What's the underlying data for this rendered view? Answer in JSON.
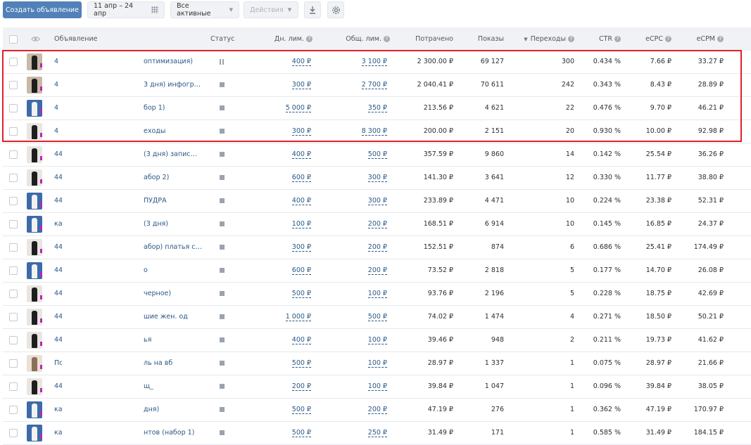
{
  "toolbar": {
    "create_label": "Создать объявление",
    "date_range": "11 апр – 24 апр",
    "filter_label": "Все активные",
    "actions_label": "Действия"
  },
  "columns": {
    "ad": "Объявление",
    "status": "Статус",
    "daily_limit": "Дн. лим.",
    "total_limit": "Общ. лим.",
    "spent": "Потрачено",
    "impressions": "Показы",
    "clicks": "Переходы",
    "ctr": "CTR",
    "ecpc": "eCPC",
    "ecpm": "eCPM"
  },
  "rows": [
    {
      "name": "4",
      "name_tail": "оптимизация)",
      "status": "paused",
      "daily": "400 ₽",
      "total": "3 100 ₽",
      "spent": "2 300.00 ₽",
      "impr": "69 127",
      "clicks": "300",
      "ctr": "0.434 %",
      "ecpc": "7.66 ₽",
      "ecpm": "33.27 ₽",
      "thumb": "multi"
    },
    {
      "name": "4",
      "name_tail": "3 дня) инфогр…",
      "status": "stopped",
      "daily": "300 ₽",
      "total": "2 700 ₽",
      "spent": "2 040.41 ₽",
      "impr": "70 611",
      "clicks": "242",
      "ctr": "0.343 %",
      "ecpc": "8.43 ₽",
      "ecpm": "28.89 ₽",
      "thumb": "multi"
    },
    {
      "name": "4",
      "name_tail": "бор 1)",
      "status": "stopped",
      "daily": "5 000 ₽",
      "total": "350 ₽",
      "spent": "213.56 ₽",
      "impr": "4 621",
      "clicks": "22",
      "ctr": "0.476 %",
      "ecpc": "9.70 ₽",
      "ecpm": "46.21 ₽",
      "thumb": "blue"
    },
    {
      "name": "4",
      "name_tail": "еходы",
      "status": "stopped",
      "daily": "300 ₽",
      "total": "8 300 ₽",
      "spent": "200.00 ₽",
      "impr": "2 151",
      "clicks": "20",
      "ctr": "0.930 %",
      "ecpc": "10.00 ₽",
      "ecpm": "92.98 ₽",
      "thumb": "dark"
    },
    {
      "name": "44",
      "name_tail": "(3 дня) запис…",
      "status": "stopped",
      "daily": "400 ₽",
      "total": "500 ₽",
      "spent": "357.59 ₽",
      "impr": "9 860",
      "clicks": "14",
      "ctr": "0.142 %",
      "ecpc": "25.54 ₽",
      "ecpm": "36.26 ₽",
      "thumb": "dark"
    },
    {
      "name": "44",
      "name_tail": "абор 2)",
      "status": "stopped",
      "daily": "600 ₽",
      "total": "300 ₽",
      "spent": "141.30 ₽",
      "impr": "3 641",
      "clicks": "12",
      "ctr": "0.330 %",
      "ecpc": "11.77 ₽",
      "ecpm": "38.80 ₽",
      "thumb": "dark"
    },
    {
      "name": "44",
      "name_tail": "ПУДРА",
      "status": "stopped",
      "daily": "400 ₽",
      "total": "300 ₽",
      "spent": "233.89 ₽",
      "impr": "4 471",
      "clicks": "10",
      "ctr": "0.224 %",
      "ecpc": "23.38 ₽",
      "ecpm": "52.31 ₽",
      "thumb": "blue"
    },
    {
      "name": "ка",
      "name_tail": "(3 дня)",
      "status": "stopped",
      "daily": "100 ₽",
      "total": "200 ₽",
      "spent": "168.51 ₽",
      "impr": "6 914",
      "clicks": "10",
      "ctr": "0.145 %",
      "ecpc": "16.85 ₽",
      "ecpm": "24.37 ₽",
      "thumb": "blue"
    },
    {
      "name": "44",
      "name_tail": "абор) платья с…",
      "status": "stopped",
      "daily": "300 ₽",
      "total": "200 ₽",
      "spent": "152.51 ₽",
      "impr": "874",
      "clicks": "6",
      "ctr": "0.686 %",
      "ecpc": "25.41 ₽",
      "ecpm": "174.49 ₽",
      "thumb": "dark"
    },
    {
      "name": "44",
      "name_tail": "о",
      "status": "stopped",
      "daily": "600 ₽",
      "total": "200 ₽",
      "spent": "73.52 ₽",
      "impr": "2 818",
      "clicks": "5",
      "ctr": "0.177 %",
      "ecpc": "14.70 ₽",
      "ecpm": "26.08 ₽",
      "thumb": "blue"
    },
    {
      "name": "44",
      "name_tail": "черное)",
      "status": "stopped",
      "daily": "500 ₽",
      "total": "100 ₽",
      "spent": "93.76 ₽",
      "impr": "2 196",
      "clicks": "5",
      "ctr": "0.228 %",
      "ecpc": "18.75 ₽",
      "ecpm": "42.69 ₽",
      "thumb": "dark"
    },
    {
      "name": "44",
      "name_tail": "шие жен. од",
      "status": "stopped",
      "daily": "1 000 ₽",
      "total": "500 ₽",
      "spent": "74.02 ₽",
      "impr": "1 474",
      "clicks": "4",
      "ctr": "0.271 %",
      "ecpc": "18.50 ₽",
      "ecpm": "50.21 ₽",
      "thumb": "dark"
    },
    {
      "name": "44",
      "name_tail": "ья",
      "status": "stopped",
      "daily": "400 ₽",
      "total": "100 ₽",
      "spent": "39.46 ₽",
      "impr": "948",
      "clicks": "2",
      "ctr": "0.211 %",
      "ecpc": "19.73 ₽",
      "ecpm": "41.62 ₽",
      "thumb": "dark"
    },
    {
      "name": "Пс",
      "name_tail": "ль на вб",
      "status": "stopped",
      "daily": "500 ₽",
      "total": "100 ₽",
      "spent": "28.97 ₽",
      "impr": "1 337",
      "clicks": "1",
      "ctr": "0.075 %",
      "ecpc": "28.97 ₽",
      "ecpm": "21.66 ₽",
      "thumb": "light"
    },
    {
      "name": "44",
      "name_tail": "щ_",
      "status": "stopped",
      "daily": "200 ₽",
      "total": "100 ₽",
      "spent": "39.84 ₽",
      "impr": "1 047",
      "clicks": "1",
      "ctr": "0.096 %",
      "ecpc": "39.84 ₽",
      "ecpm": "38.05 ₽",
      "thumb": "dark"
    },
    {
      "name": "ка",
      "name_tail": "дня)",
      "status": "stopped",
      "daily": "500 ₽",
      "total": "200 ₽",
      "spent": "47.19 ₽",
      "impr": "276",
      "clicks": "1",
      "ctr": "0.362 %",
      "ecpc": "47.19 ₽",
      "ecpm": "170.97 ₽",
      "thumb": "blue"
    },
    {
      "name": "ка",
      "name_tail": "нтов (набор 1)",
      "status": "stopped",
      "daily": "500 ₽",
      "total": "250 ₽",
      "spent": "31.49 ₽",
      "impr": "171",
      "clicks": "1",
      "ctr": "0.585 %",
      "ecpc": "31.49 ₽",
      "ecpm": "184.15 ₽",
      "thumb": "blue"
    }
  ],
  "thumb_colors": {
    "multi": "#c9b9a8",
    "blue": "#3d6aa8",
    "dark": "#e9e6e2",
    "light": "#ece0d6"
  },
  "accent": "#5181b8",
  "highlight_color": "#e0212b"
}
